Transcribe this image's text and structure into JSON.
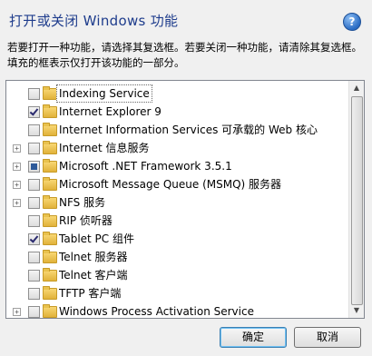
{
  "window": {
    "title": "打开或关闭 Windows 功能",
    "help_symbol": "?"
  },
  "description": "若要打开一种功能，请选择其复选框。若要关闭一种功能，请清除其复选框。填充的框表示仅打开该功能的一部分。",
  "features": [
    {
      "label": "Indexing Service",
      "expandable": false,
      "state": "unchecked",
      "selected": true
    },
    {
      "label": "Internet Explorer 9",
      "expandable": false,
      "state": "checked",
      "selected": false
    },
    {
      "label": "Internet Information Services 可承载的 Web 核心",
      "expandable": false,
      "state": "unchecked",
      "selected": false
    },
    {
      "label": "Internet 信息服务",
      "expandable": true,
      "state": "unchecked",
      "selected": false
    },
    {
      "label": "Microsoft .NET Framework 3.5.1",
      "expandable": true,
      "state": "partial",
      "selected": false
    },
    {
      "label": "Microsoft Message Queue (MSMQ) 服务器",
      "expandable": true,
      "state": "unchecked",
      "selected": false
    },
    {
      "label": "NFS 服务",
      "expandable": true,
      "state": "unchecked",
      "selected": false
    },
    {
      "label": "RIP 侦听器",
      "expandable": false,
      "state": "unchecked",
      "selected": false
    },
    {
      "label": "Tablet PC 组件",
      "expandable": false,
      "state": "checked",
      "selected": false
    },
    {
      "label": "Telnet 服务器",
      "expandable": false,
      "state": "unchecked",
      "selected": false
    },
    {
      "label": "Telnet 客户端",
      "expandable": false,
      "state": "unchecked",
      "selected": false
    },
    {
      "label": "TFTP 客户端",
      "expandable": false,
      "state": "unchecked",
      "selected": false
    },
    {
      "label": "Windows Process Activation Service",
      "expandable": true,
      "state": "unchecked",
      "selected": false
    }
  ],
  "buttons": {
    "ok": "确定",
    "cancel": "取消"
  }
}
